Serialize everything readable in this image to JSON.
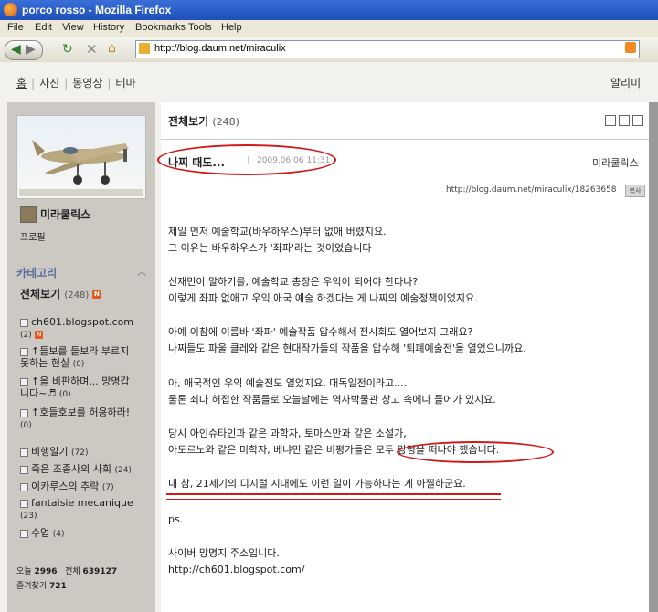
{
  "window": {
    "title": "porco rosso - Mozilla Firefox"
  },
  "menu": [
    "File",
    "Edit",
    "View",
    "History",
    "Bookmarks",
    "Tools",
    "Help"
  ],
  "address": {
    "url": "http://blog.daum.net/miraculix"
  },
  "topnav": {
    "items": [
      "홈",
      "사진",
      "동영상",
      "테마"
    ],
    "notice": "알리미"
  },
  "sidebar": {
    "profile_name": "미라쿨릭스",
    "profile_link": "프로필",
    "category_heading": "카테고리",
    "all_view": {
      "label": "전체보기",
      "count": "(248)"
    },
    "categories": [
      {
        "lines": [
          "ch601.blogspot.com"
        ],
        "count": "(2)",
        "new": true
      },
      {
        "lines": [
          "↑들보를 들보라 부르지",
          "못하는 현실"
        ],
        "count": "(0)"
      },
      {
        "lines": [
          "↑을 비판하며... 망명갑",
          "니다~♬"
        ],
        "count": "(0)"
      },
      {
        "lines": [
          "↑호들호보를 허용하라!"
        ],
        "count": "(0)"
      },
      {
        "lines": [
          "비행일기"
        ],
        "count": "(72)"
      },
      {
        "lines": [
          "죽은 조종사의 사회"
        ],
        "count": "(24)"
      },
      {
        "lines": [
          "이카루스의 추락"
        ],
        "count": "(7)"
      },
      {
        "lines": [
          "fantaisie mecanique"
        ],
        "count": "(23)"
      },
      {
        "lines": [
          "수업"
        ],
        "count": "(4)"
      }
    ],
    "stats": {
      "today_label": "오늘",
      "today": "2996",
      "total_label": "전체",
      "total": "639127",
      "fav_label": "즐겨찾기",
      "fav": "721"
    }
  },
  "content": {
    "heading": "전체보기",
    "count": "(248)",
    "post": {
      "title": "나찌 때도...",
      "date": "2009.06.06 11:31",
      "author": "미라쿨릭스",
      "url": "http://blog.daum.net/miraculix/18263658",
      "badge": "복사",
      "paragraphs": [
        [
          "제일 먼저 예술학교(바우하우스)부터 없애 버렸지요.",
          "그 이유는 바우하우스가 '좌파'라는 것이었습니다"
        ],
        [
          "신재민이 말하기를, 예술학교 총장은 우익이 되어야 한다나?",
          "이렇게 좌파 없애고 우익 애국 예술 하겠다는 게 나찌의 예술정책이었지요."
        ],
        [
          "아예 이참에 이름바 '좌파' 예술작품 압수해서 전시회도 열어보지 그래요?",
          "나찌들도 파울 클레와 같은 현대작가들의 작품을 압수해 '퇴폐예술전'을 열었으니까요."
        ],
        [
          "아, 애국적인 우익 예술전도 열었지요. 대독일전이라고....",
          "물론 죄다 허접한 작품들로 오늘날에는 역사박물관 창고 속에나 들어가 있지요."
        ],
        [
          "당시 아인슈타인과 같은 과학자, 토마스만과 같은 소설가,",
          "아도르노와 같은 미학자, 베냐민 같은 비평가들은 모두 망명을 떠나야 했습니다."
        ],
        [
          "내 참, 21세기의 디지털 시대에도 이런 일이 가능하다는 게 아찔하군요."
        ],
        [
          "ps."
        ],
        [
          "사이버 망명지 주소입니다.",
          "http://ch601.blogspot.com/"
        ]
      ]
    }
  }
}
